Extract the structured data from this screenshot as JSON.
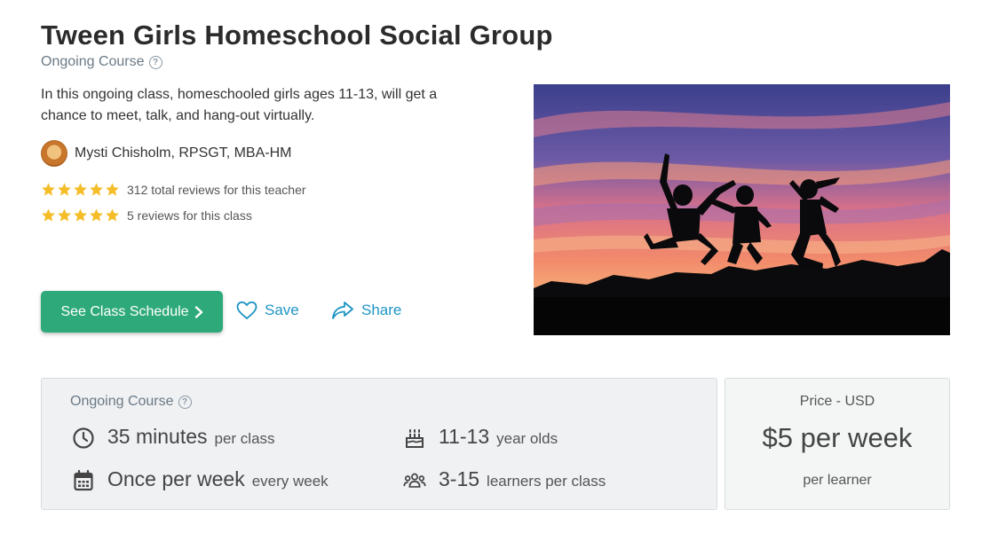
{
  "course": {
    "title": "Tween Girls Homeschool Social Group",
    "type_label": "Ongoing Course",
    "description": "In this ongoing class, homeschooled girls ages 11-13, will get a chance to meet, talk, and hang-out virtually."
  },
  "teacher": {
    "name": "Mysti Chisholm, RPSGT, MBA-HM"
  },
  "ratings": [
    {
      "stars": 5,
      "text": "312 total reviews for this teacher"
    },
    {
      "stars": 5,
      "text": "5 reviews for this class"
    }
  ],
  "actions": {
    "schedule_label": "See Class Schedule",
    "save_label": "Save",
    "share_label": "Share"
  },
  "details": {
    "label": "Ongoing Course",
    "duration_value": "35 minutes",
    "duration_unit": "per class",
    "ages_value": "11-13",
    "ages_unit": "year olds",
    "frequency_value": "Once per week",
    "frequency_unit": "every week",
    "size_value": "3-15",
    "size_unit": "learners per class"
  },
  "price": {
    "label": "Price - USD",
    "value": "$5 per week",
    "unit": "per learner"
  },
  "colors": {
    "accent_green": "#2eaa7a",
    "link_blue": "#1f95c4",
    "star_yellow": "#f6bd2a"
  },
  "icons": {
    "help": "question-circle-icon",
    "save": "heart-icon",
    "share": "share-arrow-icon",
    "duration": "clock-icon",
    "ages": "birthday-cake-icon",
    "frequency": "calendar-icon",
    "size": "group-icon"
  }
}
